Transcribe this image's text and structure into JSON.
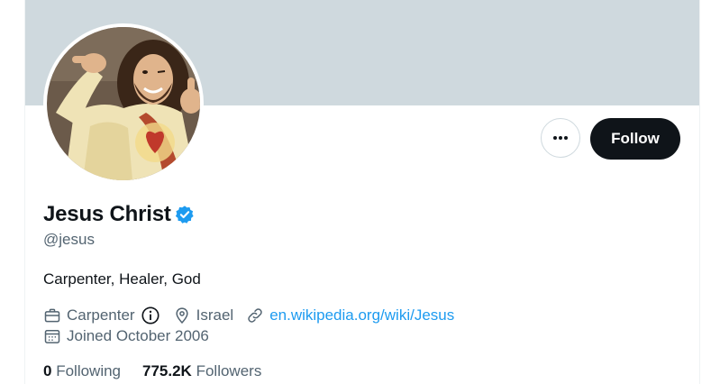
{
  "profile": {
    "display_name": "Jesus Christ",
    "handle": "@jesus",
    "bio": "Carpenter, Healer, God",
    "profession": "Carpenter",
    "location": "Israel",
    "website": "en.wikipedia.org/wiki/Jesus",
    "joined": "Joined October 2006",
    "verified": true
  },
  "actions": {
    "follow_label": "Follow",
    "more_icon": "more-horizontal-icon"
  },
  "stats": {
    "following_count": "0",
    "following_label": "Following",
    "followers_count": "775.2K",
    "followers_label": "Followers"
  },
  "colors": {
    "banner": "#cfd9de",
    "accent": "#1d9bf0",
    "text": "#0f1419",
    "secondary": "#536471",
    "follow_button": "#0f1419"
  }
}
